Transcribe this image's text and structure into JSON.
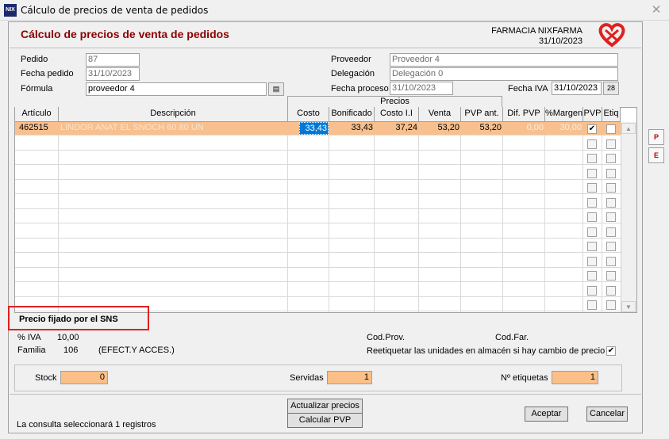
{
  "window": {
    "title": "Cálculo de precios de venta de pedidos",
    "icon": "app-icon",
    "close_glyph": "✕"
  },
  "header": {
    "form_title": "Cálculo de precios de venta de pedidos",
    "company": "FARMACIA NIXFARMA",
    "date": "31/10/2023",
    "logo": "heart-logo"
  },
  "fields": {
    "pedido_label": "Pedido",
    "pedido_value": "87",
    "fecha_pedido_label": "Fecha pedido",
    "fecha_pedido_value": "31/10/2023",
    "formula_label": "Fórmula",
    "formula_value": "proveedor 4",
    "proveedor_label": "Proveedor",
    "proveedor_value": "Proveedor 4",
    "delegacion_label": "Delegación",
    "delegacion_value": "Delegación 0",
    "fecha_proceso_label": "Fecha proceso",
    "fecha_proceso_value": "31/10/2023",
    "fecha_iva_label": "Fecha IVA",
    "fecha_iva_value": "31/10/2023"
  },
  "grid": {
    "group_label": "Precios",
    "columns": [
      "Artículo",
      "Descripción",
      "Costo",
      "Bonificado",
      "Costo I.I",
      "Venta",
      "PVP ant.",
      "Dif. PVP",
      "%Margen",
      "PVP",
      "Etiq"
    ],
    "rows": [
      {
        "articulo": "462515",
        "descripcion": "LINDOR ANAT EL SNOCH 60 80 UN",
        "costo": "33,43",
        "bonificado": "33,43",
        "costo_ii": "37,24",
        "venta": "53,20",
        "pvp_ant": "53,20",
        "dif_pvp": "0,00",
        "margen": "30,00",
        "pvp_checked": true,
        "etiq_checked": false
      }
    ],
    "empty_rows": 12
  },
  "side_buttons": [
    "P",
    "E"
  ],
  "sns_note": "Precio fijado por el SNS",
  "details": {
    "iva_label": "% IVA",
    "iva_value": "10,00",
    "familia_label": "Familia",
    "familia_code": "106",
    "familia_name": "(EFECT.Y ACCES.)",
    "cod_prov_label": "Cod.Prov.",
    "cod_far_label": "Cod.Far.",
    "reetiquetar_label": "Reetiquetar las unidades en almacén si hay cambio de precio",
    "reetiquetar_checked": true
  },
  "totals": {
    "stock_label": "Stock",
    "stock_value": "0",
    "servidas_label": "Servidas",
    "servidas_value": "1",
    "etiquetas_label": "Nº etiquetas",
    "etiquetas_value": "1"
  },
  "footer": {
    "status": "La consulta seleccionará 1  registros",
    "actualizar": "Actualizar precios",
    "calcular": "Calcular PVP",
    "aceptar": "Aceptar",
    "cancelar": "Cancelar"
  },
  "colors": {
    "title": "#8b0000",
    "selected_row": "#f7c08e",
    "highlight": "#e0201f",
    "input_orange": "#fbbf88",
    "cell_selected": "#0078d7"
  }
}
